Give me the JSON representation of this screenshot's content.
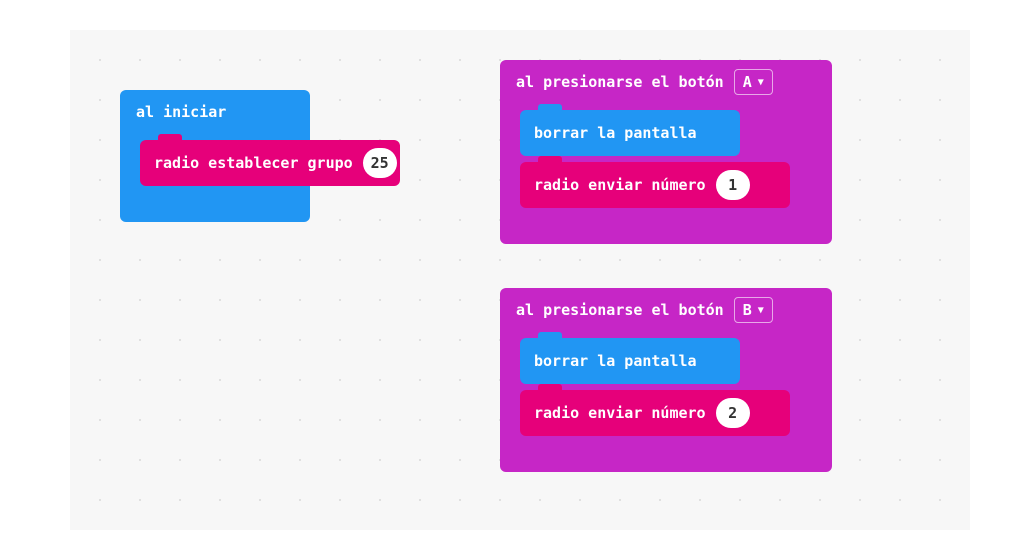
{
  "blocks": {
    "on_start": {
      "label": "al iniciar",
      "radio_set_group": {
        "label": "radio establecer grupo",
        "value": "25"
      }
    },
    "on_button_a": {
      "label": "al presionarse el botón",
      "button": "A",
      "clear_screen": {
        "label": "borrar la pantalla"
      },
      "radio_send_number": {
        "label": "radio enviar número",
        "value": "1"
      }
    },
    "on_button_b": {
      "label": "al presionarse el botón",
      "button": "B",
      "clear_screen": {
        "label": "borrar la pantalla"
      },
      "radio_send_number": {
        "label": "radio enviar número",
        "value": "2"
      }
    }
  }
}
